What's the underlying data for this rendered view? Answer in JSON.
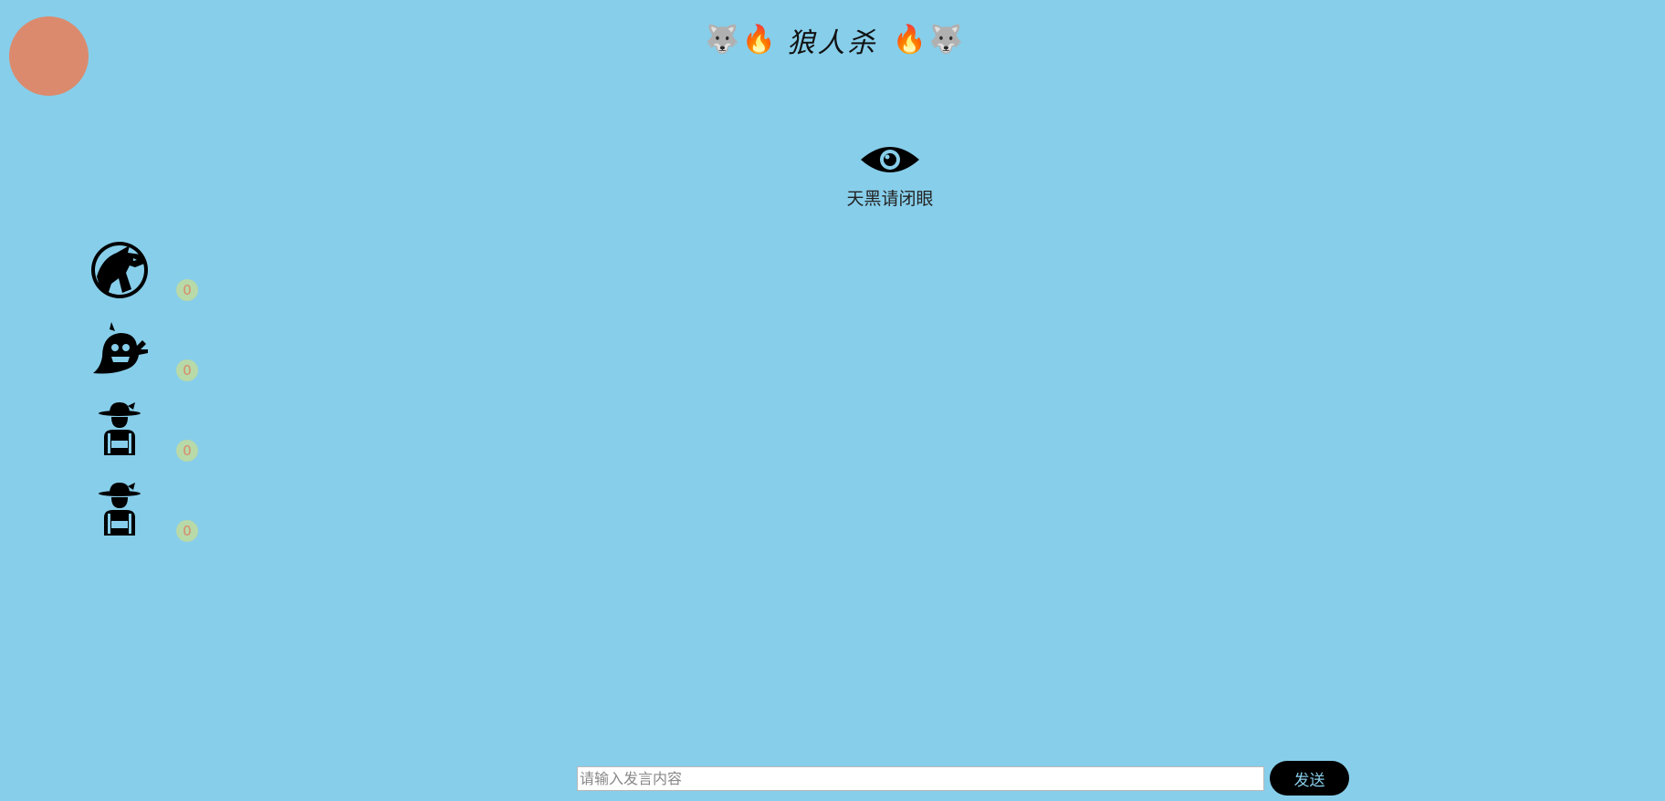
{
  "title": {
    "left_emojis": [
      "🐺",
      "🔥"
    ],
    "text": "狼人杀",
    "right_emojis": [
      "🔥",
      "🐺"
    ]
  },
  "phase": {
    "icon": "eye-icon",
    "text": "天黑请闭眼"
  },
  "roles": [
    {
      "icon": "werewolf-icon",
      "count": "0"
    },
    {
      "icon": "ghost-icon",
      "count": "0"
    },
    {
      "icon": "villager-icon",
      "count": "0"
    },
    {
      "icon": "villager-icon",
      "count": "0"
    }
  ],
  "chat": {
    "placeholder": "请输入发言内容",
    "value": "",
    "send_label": "发送"
  },
  "colors": {
    "background": "#87ceea",
    "avatar": "#db8a6e",
    "count_badge": "#b8d9a8",
    "count_text": "#d88a6a",
    "send_button": "#000000"
  }
}
